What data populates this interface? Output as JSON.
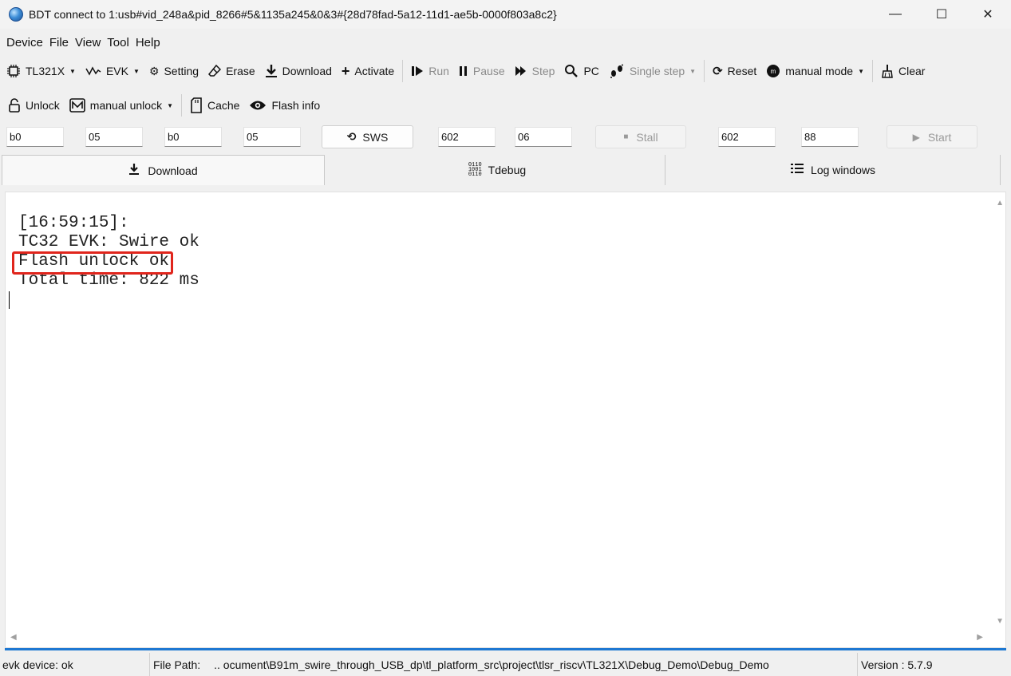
{
  "window": {
    "title": "BDT connect to 1:usb#vid_248a&pid_8266#5&1135a245&0&3#{28d78fad-5a12-11d1-ae5b-0000f803a8c2}",
    "minimize": "—",
    "maximize": "☐",
    "close": "✕"
  },
  "menu": [
    "Device",
    "File",
    "View",
    "Tool",
    "Help"
  ],
  "toolbar1": {
    "chip": "TL321X",
    "evk": "EVK",
    "setting": "Setting",
    "erase": "Erase",
    "download": "Download",
    "activate": "Activate",
    "run": "Run",
    "pause": "Pause",
    "step": "Step",
    "pc": "PC",
    "single_step": "Single step",
    "reset": "Reset",
    "manual_mode": "manual mode",
    "clear": "Clear"
  },
  "toolbar2": {
    "unlock": "Unlock",
    "manual_unlock": "manual unlock",
    "cache": "Cache",
    "flash_info": "Flash info"
  },
  "registers": {
    "f1": "b0",
    "f2": "05",
    "f3": "b0",
    "f4": "05",
    "sws": "SWS",
    "f5": "602",
    "f6": "06",
    "stall": "Stall",
    "f7": "602",
    "f8": "88",
    "start": "Start"
  },
  "tabs": [
    "Download",
    "Tdebug",
    "Log windows"
  ],
  "log": {
    "lines": [
      "[16:59:15]:",
      "TC32 EVK: Swire ok",
      "Flash unlock ok",
      "Total time: 822 ms"
    ]
  },
  "status": {
    "device": "evk device: ok",
    "file_path_label": "File Path:",
    "file_path": "..  ocument\\B91m_swire_through_USB_dp\\tl_platform_src\\project\\tlsr_riscv\\TL321X\\Debug_Demo\\Debug_Demo",
    "version": "Version : 5.7.9"
  },
  "colors": {
    "highlight": "#e0251c",
    "accent": "#1e78d2"
  }
}
